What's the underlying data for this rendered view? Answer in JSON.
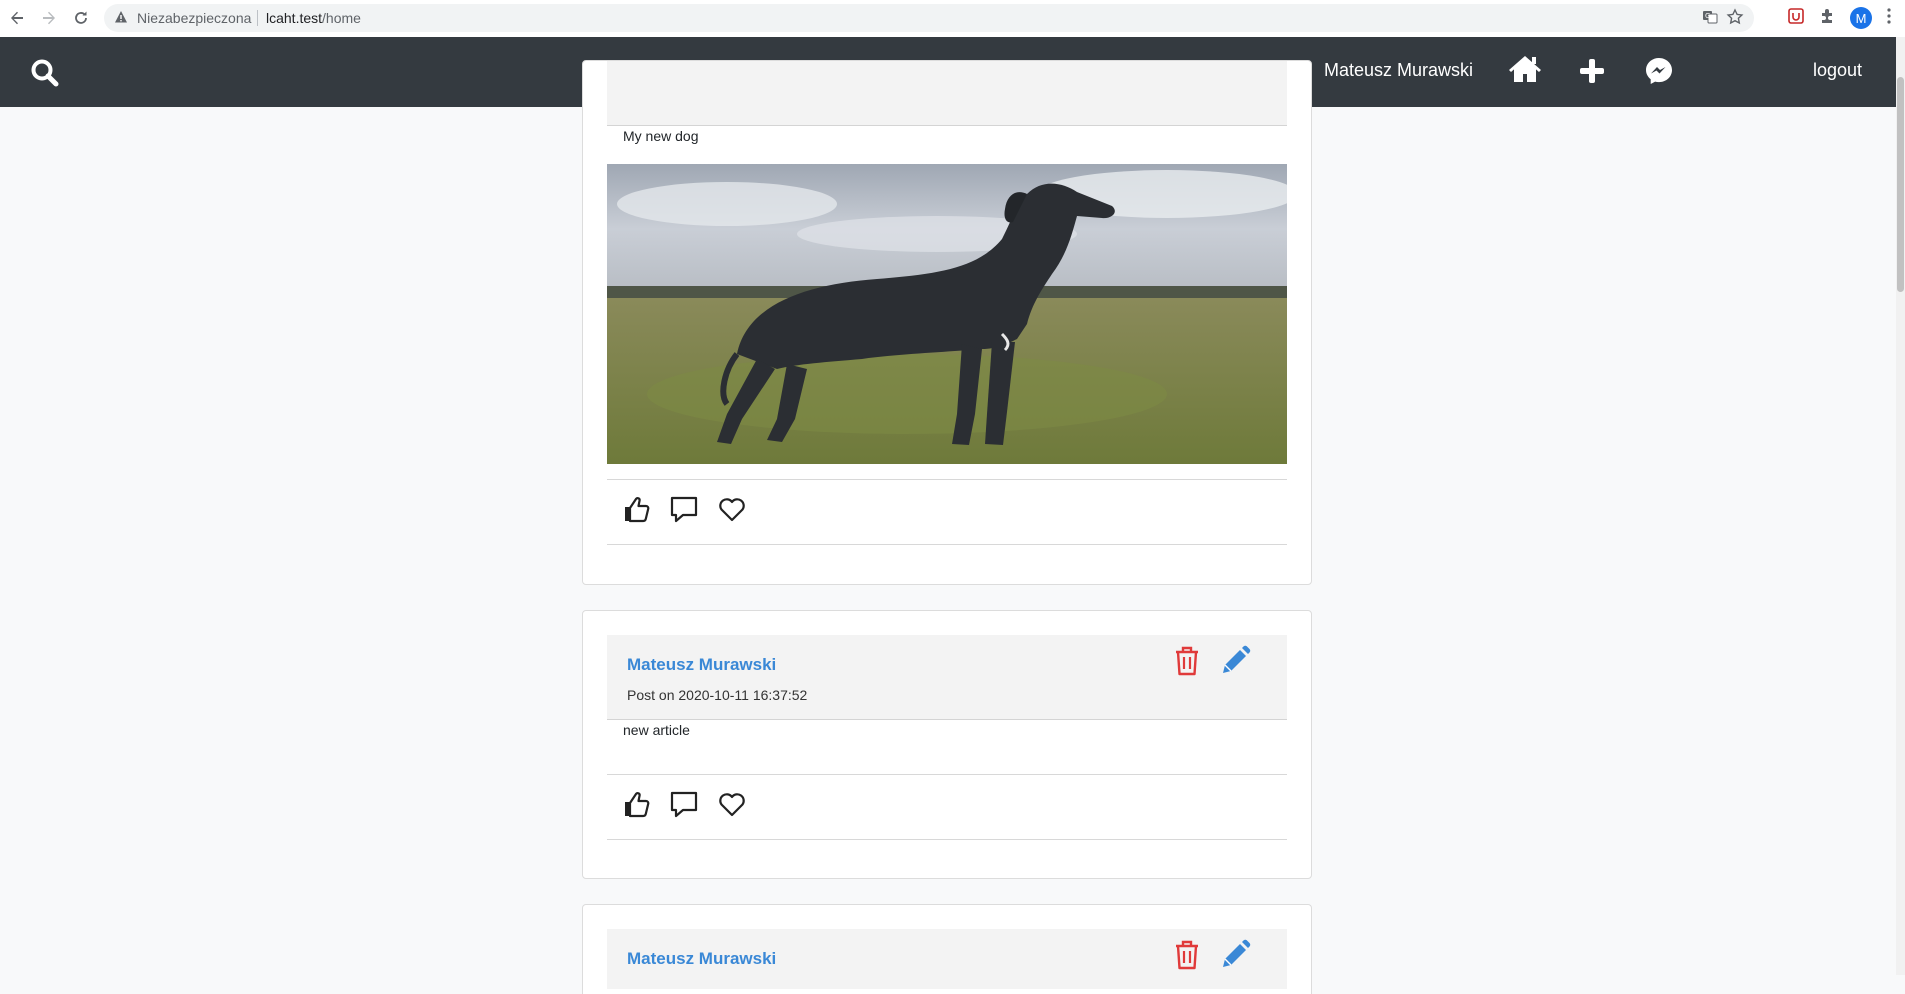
{
  "browser": {
    "security_label": "Niezabezpieczona",
    "url_host": "lcaht.test",
    "url_path": "/home",
    "profile_initial": "M"
  },
  "navbar": {
    "user_name": "Mateusz Murawski",
    "logout_label": "logout",
    "icons": [
      "search-icon",
      "home-icon",
      "plus-icon",
      "messenger-icon"
    ],
    "bg_color": "#343a40"
  },
  "posts": [
    {
      "text": "My new dog",
      "has_image": true,
      "image_alt": "Great Dane dog standing in a grassy field"
    },
    {
      "author": "Mateusz Murawski",
      "date": "Post on 2020-10-11 16:37:52",
      "text": "new article"
    },
    {
      "author": "Mateusz Murawski"
    }
  ],
  "colors": {
    "author_link": "#3a88d6",
    "delete": "#e03a3a",
    "edit": "#3a88d6"
  }
}
